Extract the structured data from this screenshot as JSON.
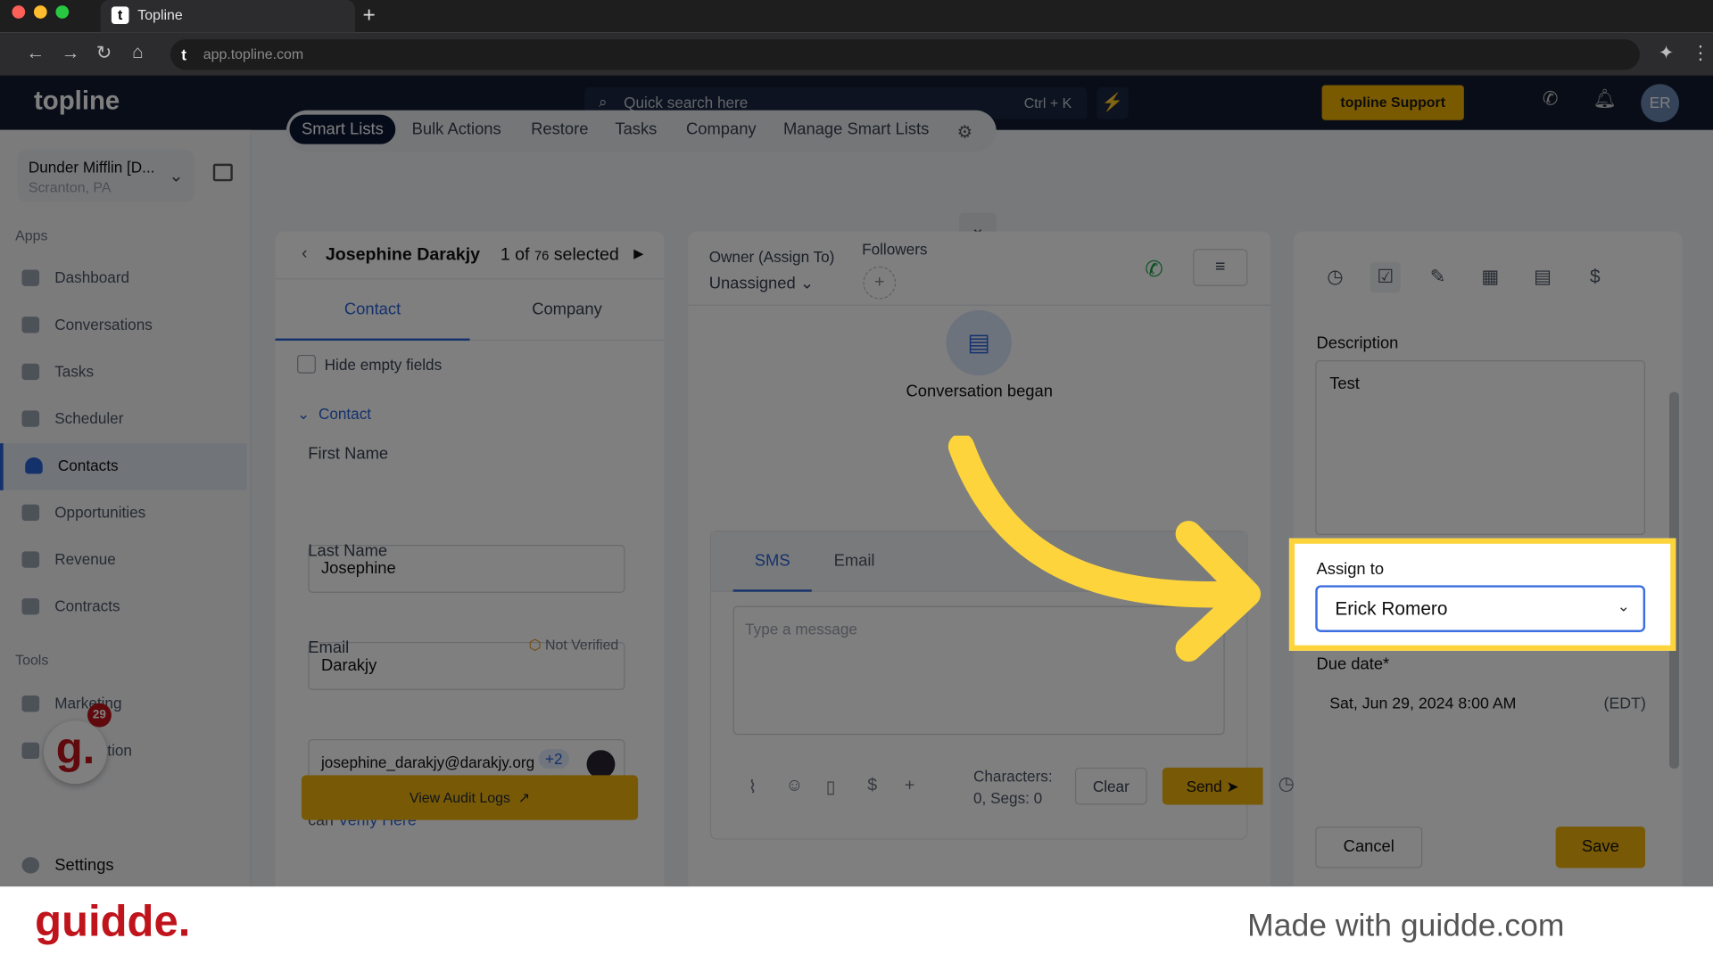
{
  "browser": {
    "tab_title": "Topline",
    "url": "app.topline.com"
  },
  "header": {
    "logo": "topline",
    "search_placeholder": "Quick search here",
    "search_shortcut": "Ctrl + K",
    "support_label": "topline Support",
    "avatar_initials": "ER"
  },
  "sidebar": {
    "location_name": "Dunder Mifflin [D...",
    "location_sub": "Scranton, PA",
    "apps_label": "Apps",
    "tools_label": "Tools",
    "apps": [
      {
        "label": "Dashboard"
      },
      {
        "label": "Conversations"
      },
      {
        "label": "Tasks"
      },
      {
        "label": "Scheduler"
      },
      {
        "label": "Contacts",
        "active": true
      },
      {
        "label": "Opportunities"
      },
      {
        "label": "Revenue"
      },
      {
        "label": "Contracts"
      }
    ],
    "tools": [
      {
        "label": "Marketing"
      },
      {
        "label": "Automation"
      }
    ],
    "settings_label": "Settings",
    "guidde_badge_count": "29"
  },
  "topnav": {
    "items": [
      "Smart Lists",
      "Bulk Actions",
      "Restore",
      "Tasks",
      "Company",
      "Manage Smart Lists"
    ],
    "active": "Smart Lists"
  },
  "contact_panel": {
    "name": "Josephine Darakjy",
    "selection_prefix": "1 of",
    "selection_total": "76",
    "selection_suffix": "selected",
    "tabs": [
      "Contact",
      "Company"
    ],
    "active_tab": "Contact",
    "hide_empty_label": "Hide empty fields",
    "hide_empty_checked": false,
    "section": "Contact",
    "first_name_label": "First Name",
    "first_name": "Josephine",
    "last_name_label": "Last Name",
    "last_name": "Darakjy",
    "email_label": "Email",
    "email_status": "Not Verified",
    "email": "josephine_darakjy@darakjy.org",
    "email_extra": "+2",
    "verify_text": "This email is Not Verified and you can",
    "verify_link": "Verify Here",
    "audit_button": "View Audit Logs"
  },
  "conversation": {
    "owner_label": "Owner (Assign To)",
    "owner_value": "Unassigned",
    "followers_label": "Followers",
    "began": "Conversation began",
    "tabs": [
      "SMS",
      "Email"
    ],
    "active_tab": "SMS",
    "message_placeholder": "Type a message",
    "chars_label": "Characters:",
    "chars_value": "0, Segs: 0",
    "clear_label": "Clear",
    "send_label": "Send"
  },
  "task_panel": {
    "description_label": "Description",
    "description": "Test",
    "assign_label": "Assign to",
    "assign_value": "Erick Romero",
    "due_label": "Due date*",
    "due_value": "Sat, Jun 29, 2024 8:00 AM",
    "timezone": "(EDT)",
    "cancel_label": "Cancel",
    "save_label": "Save"
  },
  "footer": {
    "brand": "guidde.",
    "made_with": "Made with guidde.com"
  },
  "colors": {
    "accent_yellow": "#f1b30c",
    "highlight": "#fdd43c",
    "primary_blue": "#2a62d8",
    "header_navy": "#101a30"
  }
}
